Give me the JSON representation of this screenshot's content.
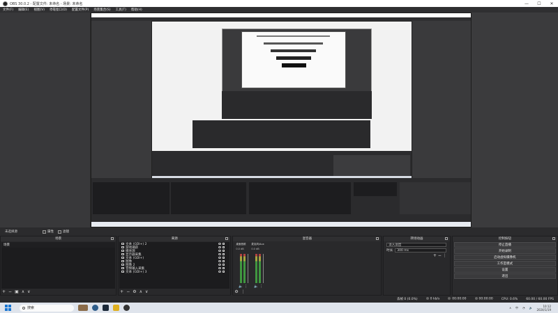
{
  "window": {
    "title": "OBS 30.0.2 - 配置文件: 未命名 - 场景: 未命名",
    "controls": [
      "—",
      "☐",
      "✕"
    ]
  },
  "menu": [
    "文件(F)",
    "编辑(E)",
    "视图(V)",
    "停靠窗口(D)",
    "配置文件(P)",
    "场景集合(S)",
    "工具(T)",
    "帮助(H)"
  ],
  "controlbar": {
    "label": "未选择源",
    "properties": "属性",
    "filters": "滤镜"
  },
  "scenes": {
    "title": "场景",
    "items": [
      "场景"
    ],
    "footer": [
      "+",
      "−",
      "▣",
      "∧",
      "∨"
    ]
  },
  "sources": {
    "title": "来源",
    "items": [
      "文本 (GDI+) 2",
      "游戏捕获",
      "媒体源",
      "显示器采集",
      "文本 (GDI+)",
      "图像",
      "图像 2",
      "音频输入采集",
      "文本 (GDI+) 3"
    ],
    "footer": [
      "+",
      "−",
      "⚙",
      "∧",
      "∨"
    ]
  },
  "mixer": {
    "title": "混音器",
    "strips": [
      {
        "name": "桌面音频",
        "db": "0.0 dB"
      },
      {
        "name": "麦克风/Aux",
        "db": "0.0 dB"
      }
    ]
  },
  "transitions": {
    "title": "转场动画",
    "select": "淡入淡出",
    "duration_label": "时长",
    "duration": "300 ms"
  },
  "controls": {
    "title": "控制按钮",
    "buttons": [
      "停止直播",
      "开始录制",
      "启动虚拟摄像机",
      "工作室模式",
      "设置",
      "退出"
    ]
  },
  "status": {
    "dropped": "丢帧 0 (0.0%)",
    "bitrate": "0 kb/s",
    "live_time": "00:00:00",
    "rec_time": "00:00:00",
    "cpu": "CPU: 0.6%",
    "fps": "60.00 / 60.00 FPS"
  },
  "taskbar": {
    "search_placeholder": "搜索",
    "tray_lang": "中",
    "time": "10:12",
    "date": "2024/1/19"
  }
}
